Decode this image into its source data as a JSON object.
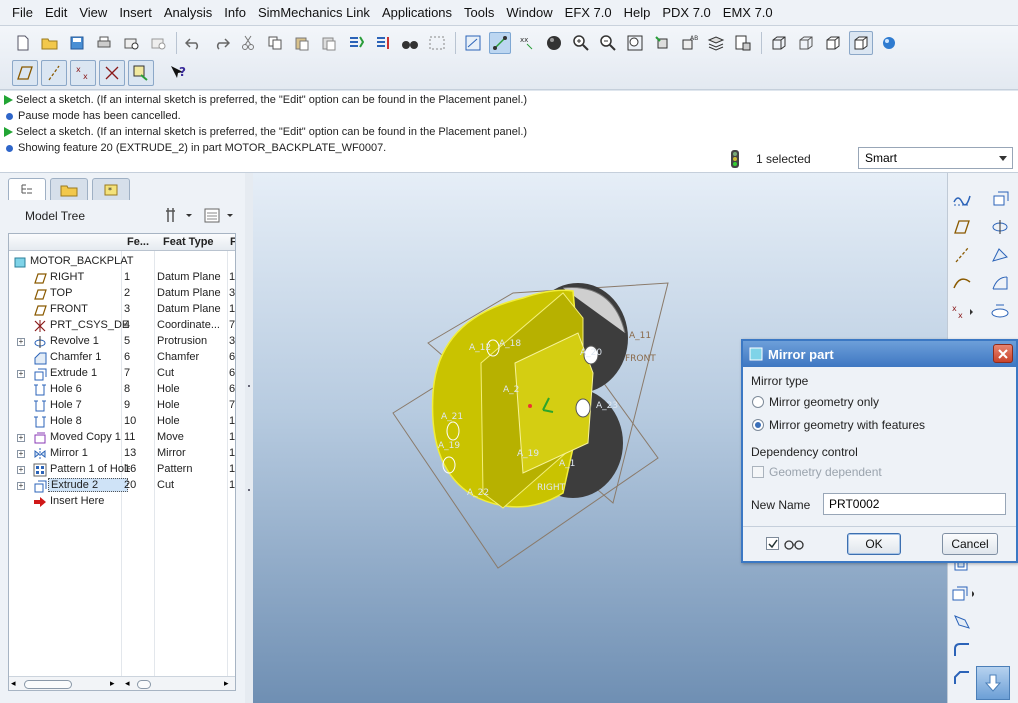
{
  "menu": [
    "File",
    "Edit",
    "View",
    "Insert",
    "Analysis",
    "Info",
    "SimMechanics Link",
    "Applications",
    "Tools",
    "Window",
    "EFX 7.0",
    "Help",
    "PDX 7.0",
    "EMX 7.0"
  ],
  "messages": [
    {
      "icon": "green-arrow-icon",
      "text": "Select a sketch. (If an internal sketch is preferred, the \"Edit\" option can be found in the Placement panel.)"
    },
    {
      "icon": "blue-dot-icon",
      "text": "Pause mode has been cancelled."
    },
    {
      "icon": "green-arrow-icon",
      "text": "Select a sketch. (If an internal sketch is preferred, the \"Edit\" option can be found in the Placement panel.)"
    },
    {
      "icon": "blue-dot-icon",
      "text": "Showing feature 20 (EXTRUDE_2) in part MOTOR_BACKPLATE_WF0007."
    }
  ],
  "selection": {
    "count_text": "1 selected",
    "filter": "Smart"
  },
  "model_tree": {
    "title": "Model Tree",
    "columns": {
      "num": "Fe...",
      "type": "Feat Type",
      "extra": "F"
    },
    "root": "MOTOR_BACKPLAT",
    "rows": [
      {
        "name": "RIGHT",
        "num": "1",
        "type": "Datum Plane",
        "extra": "1",
        "expand": false,
        "icon": "datum-plane-icon"
      },
      {
        "name": "TOP",
        "num": "2",
        "type": "Datum Plane",
        "extra": "3",
        "expand": false,
        "icon": "datum-plane-icon"
      },
      {
        "name": "FRONT",
        "num": "3",
        "type": "Datum Plane",
        "extra": "1",
        "expand": false,
        "icon": "datum-plane-icon"
      },
      {
        "name": "PRT_CSYS_DE",
        "num": "4",
        "type": "Coordinate...",
        "extra": "7",
        "expand": false,
        "icon": "csys-icon"
      },
      {
        "name": "Revolve 1",
        "num": "5",
        "type": "Protrusion",
        "extra": "3",
        "expand": true,
        "icon": "revolve-icon"
      },
      {
        "name": "Chamfer 1",
        "num": "6",
        "type": "Chamfer",
        "extra": "6",
        "expand": false,
        "icon": "chamfer-icon"
      },
      {
        "name": "Extrude 1",
        "num": "7",
        "type": "Cut",
        "extra": "6",
        "expand": true,
        "icon": "extrude-icon"
      },
      {
        "name": "Hole 6",
        "num": "8",
        "type": "Hole",
        "extra": "6",
        "expand": false,
        "icon": "hole-icon"
      },
      {
        "name": "Hole 7",
        "num": "9",
        "type": "Hole",
        "extra": "7",
        "expand": false,
        "icon": "hole-icon"
      },
      {
        "name": "Hole 8",
        "num": "10",
        "type": "Hole",
        "extra": "1",
        "expand": false,
        "icon": "hole-icon"
      },
      {
        "name": "Moved Copy 1",
        "num": "11",
        "type": "Move",
        "extra": "1",
        "expand": true,
        "icon": "move-icon"
      },
      {
        "name": "Mirror 1",
        "num": "13",
        "type": "Mirror",
        "extra": "1",
        "expand": true,
        "icon": "mirror-icon"
      },
      {
        "name": "Pattern 1 of Hole",
        "num": "16",
        "type": "Pattern",
        "extra": "1",
        "expand": true,
        "icon": "pattern-icon"
      },
      {
        "name": "Extrude 2",
        "num": "20",
        "type": "Cut",
        "extra": "1",
        "expand": true,
        "icon": "extrude-icon",
        "highlight": true
      },
      {
        "name": "Insert Here",
        "num": "",
        "type": "",
        "extra": "",
        "expand": false,
        "icon": "insert-here-arrow-icon"
      }
    ]
  },
  "graphics": {
    "labels": [
      "A_12",
      "A_18",
      "A_20",
      "A_11",
      "FRONT",
      "A_2",
      "A_21",
      "A_23",
      "A_19",
      "A_19",
      "A_1",
      "A_22",
      "RIGHT"
    ]
  },
  "dialog": {
    "title": "Mirror part",
    "mirror_type_label": "Mirror type",
    "option_geometry_only": "Mirror geometry only",
    "option_with_features": "Mirror geometry with features",
    "selected_option": "with_features",
    "dependency_label": "Dependency control",
    "geometry_dependent": "Geometry dependent",
    "new_name_label": "New Name",
    "new_name_value": "PRT0002",
    "ok": "OK",
    "cancel": "Cancel"
  },
  "colors": {
    "accent": "#3b78c4",
    "model_yellow": "#d8d200",
    "dark_part": "#3d3d3d"
  }
}
